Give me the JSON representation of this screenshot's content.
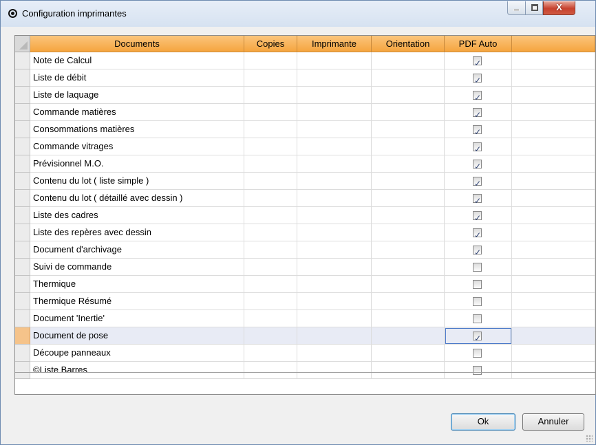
{
  "window": {
    "title": "Configuration imprimantes",
    "icon": "copyright-circle-icon",
    "controls": {
      "minimize": "minimize-icon",
      "maximize": "maximize-icon",
      "close_label": "X"
    }
  },
  "grid": {
    "columns": [
      "Documents",
      "Copies",
      "Imprimante",
      "Orientation",
      "PDF Auto"
    ],
    "rows": [
      {
        "document": "Note de Calcul",
        "copies": "",
        "imprimante": "",
        "orientation": "",
        "pdf_auto": true
      },
      {
        "document": "Liste de débit",
        "copies": "",
        "imprimante": "",
        "orientation": "",
        "pdf_auto": true
      },
      {
        "document": "Liste de laquage",
        "copies": "",
        "imprimante": "",
        "orientation": "",
        "pdf_auto": true
      },
      {
        "document": "Commande matières",
        "copies": "",
        "imprimante": "",
        "orientation": "",
        "pdf_auto": true
      },
      {
        "document": "Consommations matières",
        "copies": "",
        "imprimante": "",
        "orientation": "",
        "pdf_auto": true
      },
      {
        "document": "Commande vitrages",
        "copies": "",
        "imprimante": "",
        "orientation": "",
        "pdf_auto": true
      },
      {
        "document": "Prévisionnel M.O.",
        "copies": "",
        "imprimante": "",
        "orientation": "",
        "pdf_auto": true
      },
      {
        "document": "Contenu du lot ( liste simple )",
        "copies": "",
        "imprimante": "",
        "orientation": "",
        "pdf_auto": true
      },
      {
        "document": "Contenu du lot ( détaillé avec dessin )",
        "copies": "",
        "imprimante": "",
        "orientation": "",
        "pdf_auto": true
      },
      {
        "document": "Liste des cadres",
        "copies": "",
        "imprimante": "",
        "orientation": "",
        "pdf_auto": true
      },
      {
        "document": "Liste des repères avec dessin",
        "copies": "",
        "imprimante": "",
        "orientation": "",
        "pdf_auto": true
      },
      {
        "document": "Document d'archivage",
        "copies": "",
        "imprimante": "",
        "orientation": "",
        "pdf_auto": true
      },
      {
        "document": "Suivi de commande",
        "copies": "",
        "imprimante": "",
        "orientation": "",
        "pdf_auto": false
      },
      {
        "document": "Thermique",
        "copies": "",
        "imprimante": "",
        "orientation": "",
        "pdf_auto": false
      },
      {
        "document": "Thermique Résumé",
        "copies": "",
        "imprimante": "",
        "orientation": "",
        "pdf_auto": false
      },
      {
        "document": "Document 'Inertie'",
        "copies": "",
        "imprimante": "",
        "orientation": "",
        "pdf_auto": false
      },
      {
        "document": "Document de pose",
        "copies": "",
        "imprimante": "",
        "orientation": "",
        "pdf_auto": true,
        "selected": true
      },
      {
        "document": "Découpe panneaux",
        "copies": "",
        "imprimante": "",
        "orientation": "",
        "pdf_auto": false
      },
      {
        "document": "©Liste  Barres",
        "copies": "",
        "imprimante": "",
        "orientation": "",
        "pdf_auto": false
      }
    ]
  },
  "buttons": {
    "ok": "Ok",
    "cancel": "Annuler"
  },
  "colors": {
    "header": "#f5a53f",
    "selected_row": "#e8ebf5",
    "selected_row_header": "#f5c38a"
  }
}
